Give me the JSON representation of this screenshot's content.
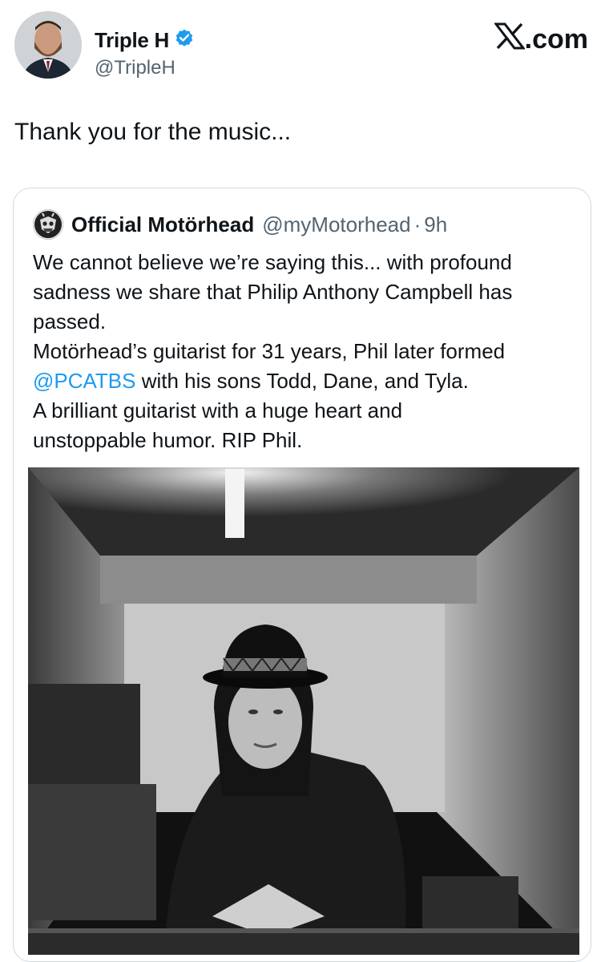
{
  "author": {
    "display_name": "Triple H",
    "handle": "@TripleH",
    "verified": true,
    "avatar_icon": "profile-avatar"
  },
  "brand": {
    "label": ".com",
    "logo_icon": "x-logo-icon"
  },
  "tweet": {
    "text": "Thank you for the music..."
  },
  "quoted_tweet": {
    "display_name": "Official Motörhead",
    "handle": "@myMotorhead",
    "separator": "·",
    "time": "9h",
    "lines": [
      "We cannot believe we’re saying this... with profound",
      "sadness we share that Philip Anthony Campbell has",
      "passed.",
      "Motörhead’s guitarist for 31 years, Phil later formed"
    ],
    "mention": "@PCATBS",
    "mention_suffix": " with his sons Todd, Dane, and Tyla.",
    "lines_after": [
      "A brilliant guitarist with a huge heart and",
      "unstoppable humor. RIP Phil."
    ]
  },
  "colors": {
    "link": "#1d9bf0",
    "verified": "#1d9bf0",
    "muted": "#536471",
    "border": "#cfd9de"
  }
}
